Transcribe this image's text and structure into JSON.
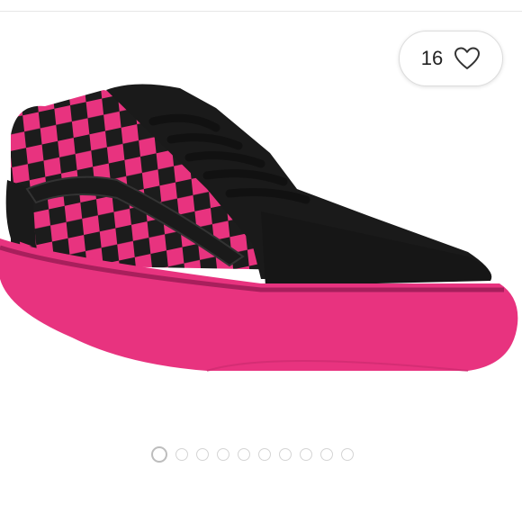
{
  "like": {
    "count": "16",
    "icon": "heart-outline-icon"
  },
  "gallery": {
    "image": "pink-black-checkerboard-sneaker",
    "total": 10,
    "active_index": 0
  },
  "colors": {
    "pink": "#e8337f",
    "black": "#1a1a1a"
  }
}
